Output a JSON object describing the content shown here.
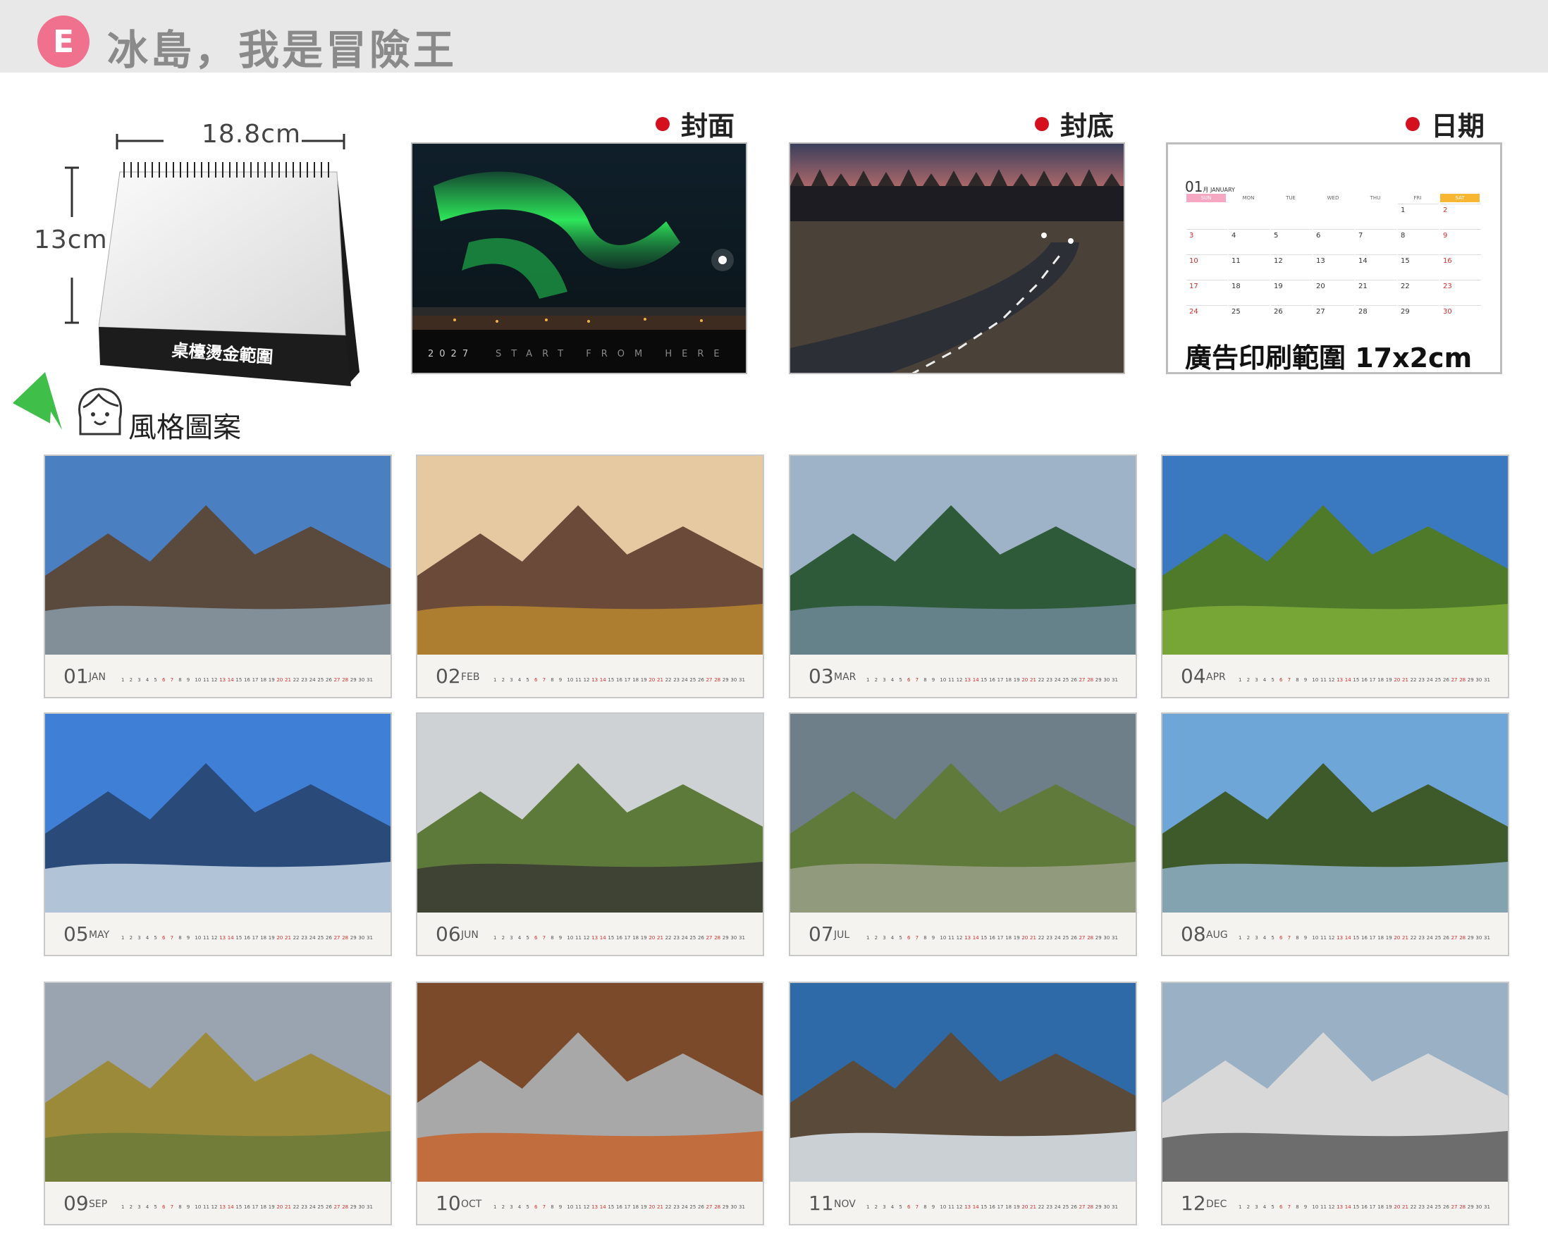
{
  "header": {
    "badge": "E",
    "title": "冰島，我是冒險王"
  },
  "size_labels": {
    "width": "18.8cm",
    "height": "13cm"
  },
  "desk_calendar": {
    "bottom_label": "桌檯燙金範圍"
  },
  "style_label": "風格圖案",
  "sections": {
    "cover": "封面",
    "back": "封底",
    "date": "日期"
  },
  "cover": {
    "year": "2027",
    "tagline": "START  FROM  HERE"
  },
  "date_page": {
    "month_num": "01",
    "month_sub": "月 JANUARY",
    "weekdays": [
      "SUN",
      "MON",
      "TUE",
      "WED",
      "THU",
      "FRI",
      "SAT"
    ],
    "ad_area": "廣告印刷範圍 17x2cm"
  },
  "months": [
    {
      "num": "01",
      "abbr": "JAN"
    },
    {
      "num": "02",
      "abbr": "FEB"
    },
    {
      "num": "03",
      "abbr": "MAR"
    },
    {
      "num": "04",
      "abbr": "APR"
    },
    {
      "num": "05",
      "abbr": "MAY"
    },
    {
      "num": "06",
      "abbr": "JUN"
    },
    {
      "num": "07",
      "abbr": "JUL"
    },
    {
      "num": "08",
      "abbr": "AUG"
    },
    {
      "num": "09",
      "abbr": "SEP"
    },
    {
      "num": "10",
      "abbr": "OCT"
    },
    {
      "num": "11",
      "abbr": "NOV"
    },
    {
      "num": "12",
      "abbr": "DEC"
    }
  ],
  "colors": {
    "badge": "#f0718d",
    "dot": "#d4101e",
    "weekend_red": "#d72d2d",
    "sat_header": "#f7b733",
    "sun_header": "#f6a7c1"
  }
}
